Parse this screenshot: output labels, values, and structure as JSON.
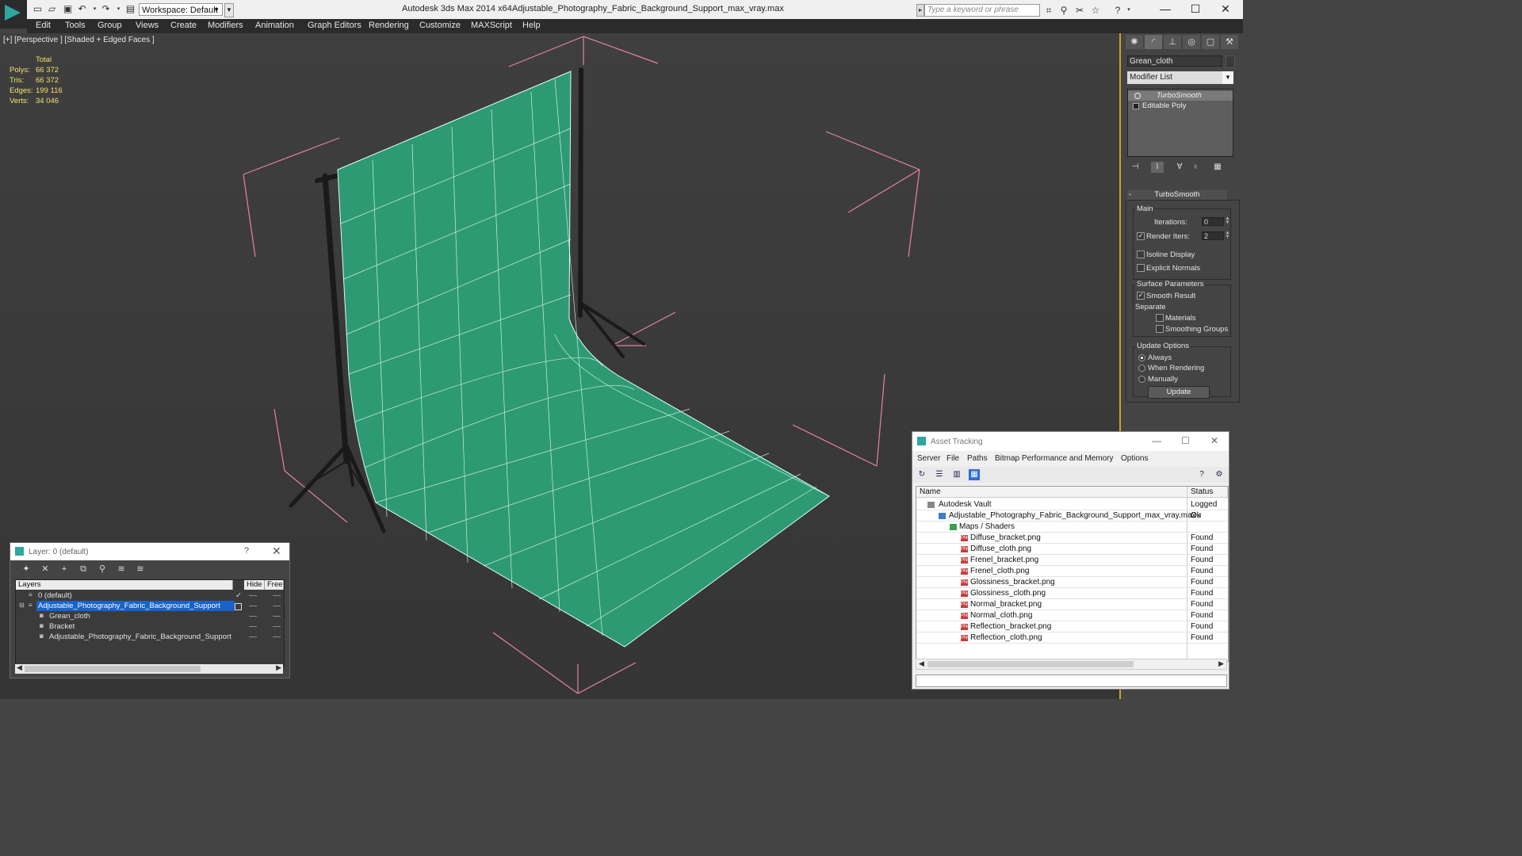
{
  "titlebar": {
    "workspace_value": "Workspace: Default",
    "app_title": "Autodesk 3ds Max  2014 x64",
    "file_title": "Adjustable_Photography_Fabric_Background_Support_max_vray.max",
    "search_placeholder": "Type a keyword or phrase",
    "window_controls": [
      "minimize-icon",
      "maximize-icon",
      "close-icon"
    ]
  },
  "menubar": {
    "items": [
      "Edit",
      "Tools",
      "Group",
      "Views",
      "Create",
      "Modifiers",
      "Animation",
      "Graph Editors",
      "Rendering",
      "Customize",
      "MAXScript",
      "Help"
    ]
  },
  "viewport": {
    "label": "[+] [Perspective ] [Shaded + Edged Faces ]",
    "stats": {
      "header": "Total",
      "rows": [
        {
          "key": "Polys:",
          "value": "66 372"
        },
        {
          "key": "Tris:",
          "value": "66 372"
        },
        {
          "key": "Edges:",
          "value": "199 116"
        },
        {
          "key": "Verts:",
          "value": "34 046"
        }
      ]
    },
    "colors": {
      "cloth": "#2e9a74",
      "wire": "#e8fff4",
      "bbox": "#e4849c",
      "stand": "#1a1a1a"
    }
  },
  "command_panel": {
    "tabs": [
      "create-icon",
      "modify-icon",
      "hierarchy-icon",
      "motion-icon",
      "display-icon",
      "utilities-icon"
    ],
    "object_name": "Grean_cloth",
    "modifier_list": "Modifier List",
    "stack": [
      {
        "label": "TurboSmooth",
        "selected": true
      },
      {
        "label": "Editable Poly",
        "selected": false
      }
    ],
    "turbosmooth": {
      "title": "TurboSmooth",
      "main_label": "Main",
      "iterations_label": "Iterations:",
      "iterations": "0",
      "render_iters_label": "Render Iters:",
      "render_iters": "2",
      "render_iters_checked": true,
      "isoline_label": "Isoline Display",
      "explicit_normals_label": "Explicit Normals",
      "surface_params_label": "Surface Parameters",
      "smooth_result_label": "Smooth Result",
      "separate_label": "Separate",
      "materials_label": "Materials",
      "smoothing_groups_label": "Smoothing Groups",
      "update_options_label": "Update Options",
      "always_label": "Always",
      "when_rendering_label": "When Rendering",
      "manually_label": "Manually",
      "update_button": "Update"
    }
  },
  "layer_dialog": {
    "title": "Layer: 0 (default)",
    "help": "?",
    "columns": [
      "Layers",
      "Hide",
      "Free"
    ],
    "rows": [
      {
        "name": "0 (default)",
        "level": 0,
        "selected": false
      },
      {
        "name": "Adjustable_Photography_Fabric_Background_Support",
        "level": 0,
        "selected": true
      },
      {
        "name": "Grean_cloth",
        "level": 1,
        "selected": false
      },
      {
        "name": "Bracket",
        "level": 1,
        "selected": false
      },
      {
        "name": "Adjustable_Photography_Fabric_Background_Support",
        "level": 1,
        "selected": false
      }
    ]
  },
  "asset_tracking": {
    "title": "Asset Tracking",
    "menu": [
      "Server",
      "File",
      "Paths",
      "Bitmap Performance and Memory",
      "Options"
    ],
    "columns": [
      "Name",
      "Status"
    ],
    "rows": [
      {
        "name": "Autodesk Vault",
        "status": "Logged Ou",
        "level": 0,
        "icon": "vault"
      },
      {
        "name": "Adjustable_Photography_Fabric_Background_Support_max_vray.max",
        "status": "Ok",
        "level": 1,
        "icon": "max"
      },
      {
        "name": "Maps / Shaders",
        "status": "",
        "level": 2,
        "icon": "maps"
      },
      {
        "name": "Diffuse_bracket.png",
        "status": "Found",
        "level": 3,
        "icon": "png"
      },
      {
        "name": "Diffuse_cloth.png",
        "status": "Found",
        "level": 3,
        "icon": "png"
      },
      {
        "name": "Frenel_bracket.png",
        "status": "Found",
        "level": 3,
        "icon": "png"
      },
      {
        "name": "Frenel_cloth.png",
        "status": "Found",
        "level": 3,
        "icon": "png"
      },
      {
        "name": "Glossiness_bracket.png",
        "status": "Found",
        "level": 3,
        "icon": "png"
      },
      {
        "name": "Glossiness_cloth.png",
        "status": "Found",
        "level": 3,
        "icon": "png"
      },
      {
        "name": "Normal_bracket.png",
        "status": "Found",
        "level": 3,
        "icon": "png"
      },
      {
        "name": "Normal_cloth.png",
        "status": "Found",
        "level": 3,
        "icon": "png"
      },
      {
        "name": "Reflection_bracket.png",
        "status": "Found",
        "level": 3,
        "icon": "png"
      },
      {
        "name": "Reflection_cloth.png",
        "status": "Found",
        "level": 3,
        "icon": "png"
      }
    ]
  }
}
